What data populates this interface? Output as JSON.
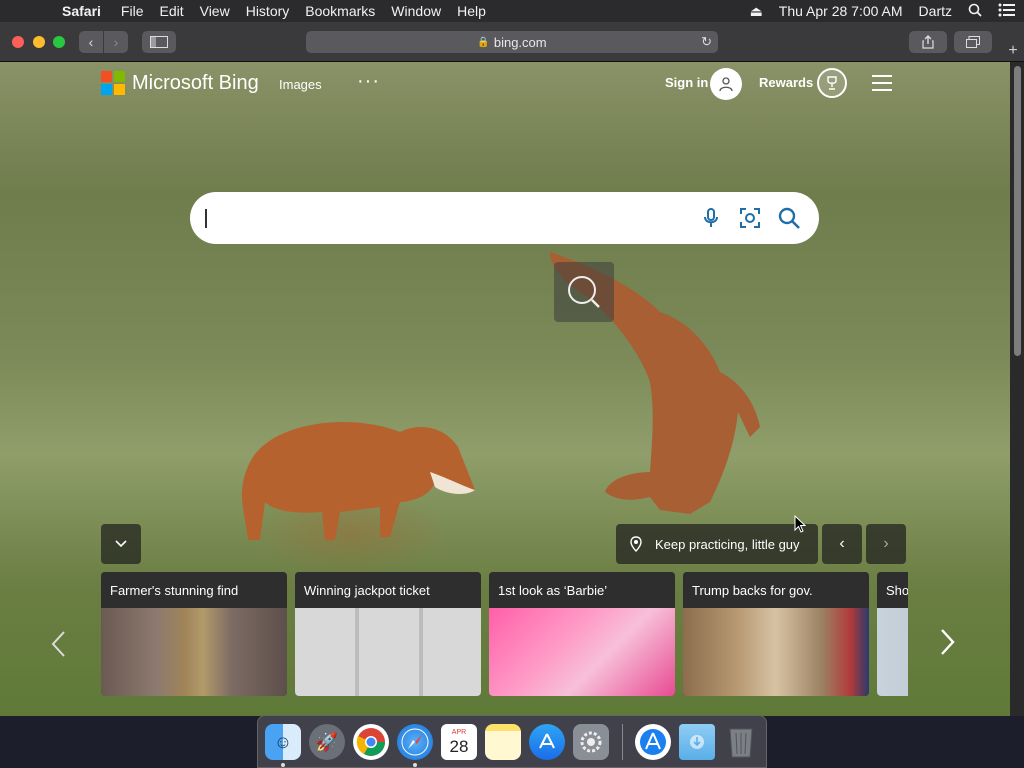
{
  "menubar": {
    "apple_icon": "apple-icon",
    "app_name": "Safari",
    "items": [
      "File",
      "Edit",
      "View",
      "History",
      "Bookmarks",
      "Window",
      "Help"
    ],
    "datetime": "Thu Apr 28  7:00 AM",
    "user": "Dartz"
  },
  "toolbar": {
    "url": "bing.com"
  },
  "bing": {
    "logo_text": "Microsoft Bing",
    "nav_images": "Images",
    "nav_more": "···",
    "signin": "Sign in",
    "rewards": "Rewards",
    "search_placeholder": ""
  },
  "caption": {
    "text": "Keep practicing, little guy"
  },
  "cards": [
    {
      "title": "Farmer's stunning find"
    },
    {
      "title": "Winning jackpot ticket"
    },
    {
      "title": "1st look as ‘Barbie’"
    },
    {
      "title": "Trump backs for gov."
    },
    {
      "title": "Sho"
    }
  ],
  "dock": {
    "calendar_month": "APR",
    "calendar_day": "28"
  },
  "colors": {
    "logo_red": "#f25022",
    "logo_green": "#7fba00",
    "logo_blue": "#00a4ef",
    "logo_yellow": "#ffb900",
    "bing_accent": "#1f6ea8"
  }
}
